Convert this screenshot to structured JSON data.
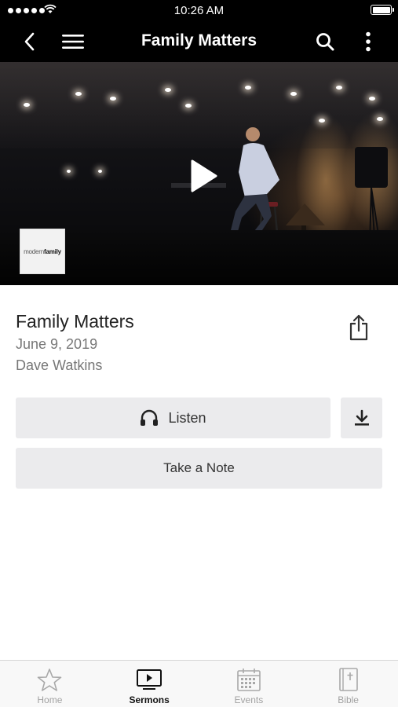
{
  "status_bar": {
    "time": "10:26 AM"
  },
  "nav": {
    "title": "Family Matters",
    "icons": [
      "back-arrow-icon",
      "hamburger-menu-icon",
      "search-icon",
      "more-vertical-icon"
    ]
  },
  "hero": {
    "thumbnail_text_regular": "modern",
    "thumbnail_text_bold": "family",
    "play_icon": "play-icon"
  },
  "sermon": {
    "title": "Family Matters",
    "date": "June 9, 2019",
    "speaker": "Dave Watkins",
    "share_icon": "share-icon"
  },
  "actions": {
    "listen_label": "Listen",
    "listen_icon": "headphones-icon",
    "download_icon": "download-icon",
    "note_label": "Take a Note"
  },
  "tabs": [
    {
      "label": "Home",
      "icon": "star-icon",
      "active": false
    },
    {
      "label": "Sermons",
      "icon": "tv-play-icon",
      "active": true
    },
    {
      "label": "Events",
      "icon": "calendar-icon",
      "active": false
    },
    {
      "label": "Bible",
      "icon": "bible-icon",
      "active": false
    }
  ],
  "colors": {
    "bar_background": "#000000",
    "button_background": "#ebebed",
    "tab_active": "#111111",
    "tab_inactive": "#a2a2a2"
  }
}
